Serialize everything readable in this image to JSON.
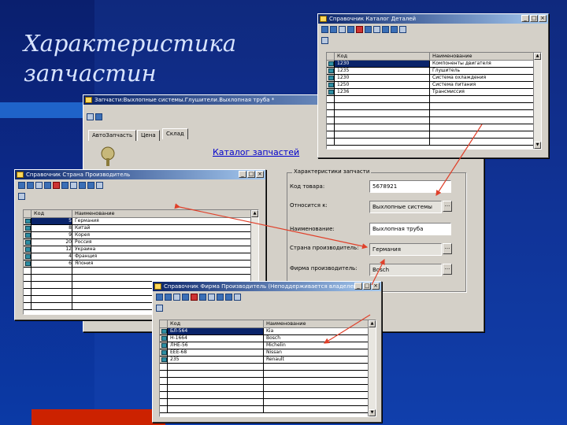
{
  "slide": {
    "title_line1": "Характеристика",
    "title_line2": "запчастин"
  },
  "main_form": {
    "title": "Запчасти:Выхлопные системы.Глушители.Выхлопная труба *",
    "tabs": [
      "АвтоЗапчасть",
      "Цена",
      "Склад"
    ],
    "catalog_link": "Каталог запчастей",
    "group_legend": "Характеристики запчасти",
    "fields": [
      {
        "label": "Код товара:",
        "value": "5678921"
      },
      {
        "label": "Относится к:",
        "value": "Выхлопные системы"
      },
      {
        "label": "Наименование:",
        "value": "Выхлопная труба"
      },
      {
        "label": "Страна производитель:",
        "value": "Германия"
      },
      {
        "label": "Фирма производитель:",
        "value": "Bosch"
      }
    ]
  },
  "catalog_window": {
    "title": "Справочник Каталог Деталей",
    "columns": [
      "Код",
      "Наименование"
    ],
    "rows": [
      {
        "code": "1230",
        "name": "Компоненты двигателя"
      },
      {
        "code": "1235",
        "name": "Глушитель"
      },
      {
        "code": "1230",
        "name": "Система охлаждения"
      },
      {
        "code": "1250",
        "name": "Система питания"
      },
      {
        "code": "1236",
        "name": "Трансмиссия"
      }
    ]
  },
  "country_window": {
    "title": "Справочник Страна Производитель",
    "columns": [
      "Код",
      "Наименование"
    ],
    "rows": [
      {
        "code": "5",
        "name": "Германия"
      },
      {
        "code": "8",
        "name": "Китай"
      },
      {
        "code": "9",
        "name": "Корея"
      },
      {
        "code": "20",
        "name": "Россия"
      },
      {
        "code": "12",
        "name": "Украина"
      },
      {
        "code": "4",
        "name": "Франция"
      },
      {
        "code": "6",
        "name": "Япония"
      }
    ]
  },
  "firm_window": {
    "title": "Справочник Фирма Производитель (Неподдерживается владелец)",
    "columns": [
      "Код",
      "Наименование"
    ],
    "rows": [
      {
        "code": "БЛ-564",
        "name": "Kia"
      },
      {
        "code": "Н-1664",
        "name": "Bosch"
      },
      {
        "code": "ЛНЕ-56",
        "name": "Michelin"
      },
      {
        "code": "ЕЕЕ-68",
        "name": "Nissan"
      },
      {
        "code": "235",
        "name": "Renault"
      }
    ]
  },
  "colors": {
    "titlebar": "#0a246a",
    "window": "#d4d0c8",
    "arrow": "#e0402a",
    "link": "#0000cc"
  }
}
